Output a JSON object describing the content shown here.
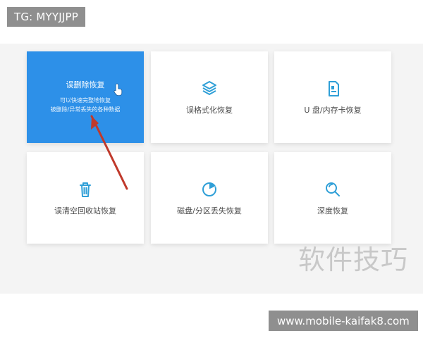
{
  "badges": {
    "top": "TG: MYYJJPP",
    "bottom": "www.mobile-kaifak8.com"
  },
  "watermark": "软件技巧",
  "cards": [
    {
      "title": "误删除恢复",
      "desc_line1": "可以快速完整地恢复",
      "desc_line2": "被删除/异常丢失的各种数据",
      "active": true,
      "icon": "cursor-icon"
    },
    {
      "title": "误格式化恢复",
      "icon": "layers-icon"
    },
    {
      "title": "U 盘/内存卡恢复",
      "icon": "sd-card-icon"
    },
    {
      "title": "误清空回收站恢复",
      "icon": "trash-icon"
    },
    {
      "title": "磁盘/分区丢失恢复",
      "icon": "disk-partition-icon"
    },
    {
      "title": "深度恢复",
      "icon": "search-icon"
    }
  ],
  "colors": {
    "accent": "#2d90e8",
    "icon": "#2f9fd7",
    "arrow": "#c0392b",
    "panel": "#f4f4f4"
  }
}
